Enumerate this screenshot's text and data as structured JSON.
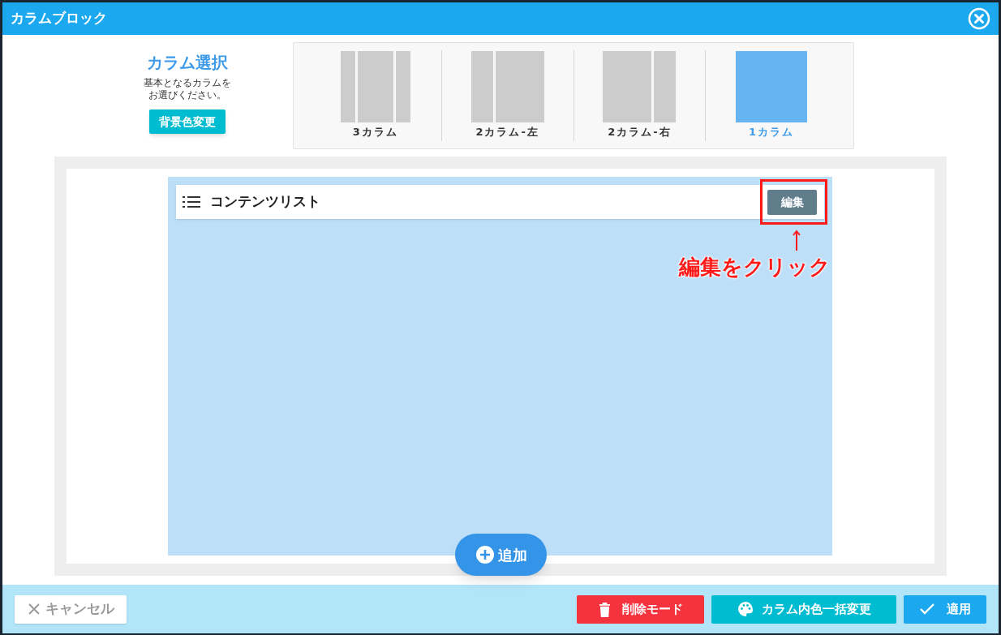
{
  "window": {
    "title": "カラムブロック"
  },
  "column_select": {
    "heading": "カラム選択",
    "description_lines": [
      "基本となるカラムを",
      "お選びください。"
    ],
    "background_button": "背景色変更",
    "options": [
      {
        "kind": "three",
        "label": "3カラム",
        "selected": false
      },
      {
        "kind": "left",
        "label": "2カラム-左",
        "selected": false
      },
      {
        "kind": "right",
        "label": "2カラム-右",
        "selected": false
      },
      {
        "kind": "one",
        "label": "1カラム",
        "selected": true
      }
    ]
  },
  "content_items": [
    {
      "title": "コンテンツリスト",
      "edit_button": "編集"
    }
  ],
  "annotation": {
    "text": "編集をクリック"
  },
  "add_button": "追加",
  "footer": {
    "cancel": "キャンセル",
    "delete_mode": "削除モード",
    "bulk_color": "カラム内色一括変更",
    "apply": "適用"
  }
}
